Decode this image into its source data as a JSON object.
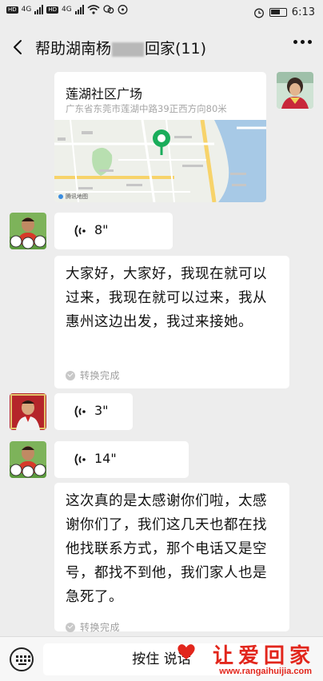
{
  "status_bar": {
    "network_badges": [
      "HD",
      "HD"
    ],
    "network_types": [
      "4G",
      "4G"
    ],
    "time": "6:13"
  },
  "header": {
    "title_start": "帮助湖南杨",
    "title_end": "回家(11)"
  },
  "messages": [
    {
      "type": "location",
      "sender": "self",
      "place_name": "莲湖社区广场",
      "address": "广东省东莞市莲湖中路39正西方向80米",
      "map_credit": "腾讯地图"
    },
    {
      "type": "voice",
      "sender": "other-1",
      "duration": "8\""
    },
    {
      "type": "transcript",
      "text": "大家好，大家好，我现在就可以过来，我现在就可以过来，我从惠州这边出发，我过来接她。",
      "status": "转换完成"
    },
    {
      "type": "voice",
      "sender": "other-2",
      "duration": "3\""
    },
    {
      "type": "voice",
      "sender": "other-1",
      "duration": "14\""
    },
    {
      "type": "transcript",
      "text": "这次真的是太感谢你们啦，太感谢你们了，我们这几天也都在找他找联系方式，那个电话又是空号，都找不到他，我们家人也是急死了。",
      "status": "转换完成"
    }
  ],
  "input_bar": {
    "hold_to_talk": "按住 说话"
  },
  "watermark": {
    "brand": "让爱回家",
    "url": "www.rangaihuijia.com"
  },
  "colors": {
    "background": "#ededed",
    "bubble": "#ffffff",
    "watermark_red": "#e2261c",
    "map_pin": "#1aad5b"
  },
  "icons": [
    "back-arrow-icon",
    "more-icon",
    "voice-wave-icon",
    "check-icon",
    "keyboard-icon",
    "map-pin-icon",
    "heart-icon"
  ]
}
